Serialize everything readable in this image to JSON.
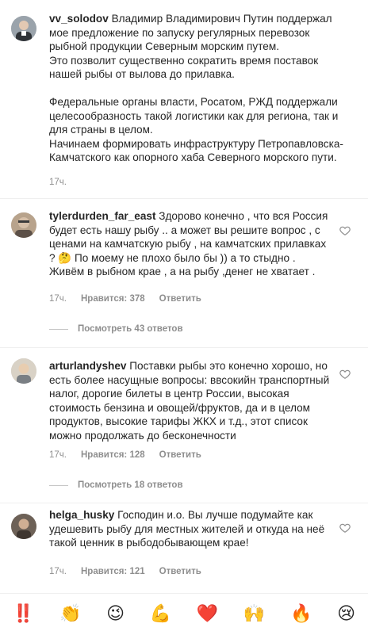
{
  "post": {
    "username": "vv_solodov",
    "paragraph1": "Владимир Владимирович Путин поддержал мое предложение по запуску регулярных перевозок рыбной продукции Северным морским путем.\nЭто позволит существенно сократить время поставок нашей рыбы от вылова до прилавка.",
    "paragraph2": "Федеральные органы власти, Росатом, РЖД поддержали целесообразность такой логистики как для региона, так и для страны в целом.\nНачинаем формировать инфраструктуру Петропавловска-Камчатского как опорного хаба Северного морского пути.",
    "time": "17ч."
  },
  "comments": [
    {
      "username": "tylerdurden_far_east",
      "text": "Здорово конечно , что вся Россия будет есть нашу рыбу .. а может вы решите вопрос , с ценами на камчатскую рыбу , на камчатских прилавках ? 🤔 По моему не плохо было бы )) а то стыдно . Живём в рыбном крае , а на рыбу ,денег не хватает .",
      "time": "17ч.",
      "likes": "Нравится: 378",
      "reply": "Ответить",
      "view_replies": "Посмотреть 43 ответов"
    },
    {
      "username": "arturlandyshev",
      "text": "Поставки рыбы это конечно хорошо, но есть более насущные вопросы: ввсокийн транспортный налог, дорогие билеты в центр России, высокая стоимость бензина и овощей/фруктов, да и в целом продуктов, высокие тарифы ЖКХ и т.д., этот список можно продолжать до бесконечности",
      "time": "17ч.",
      "likes": "Нравится: 128",
      "reply": "Ответить",
      "view_replies": "Посмотреть 18 ответов"
    },
    {
      "username": "helga_husky",
      "text": "Господин и.о. Вы лучше подумайте как удешевить рыбу для местных жителей и откуда на неё такой ценник в рыбодобывающем крае!",
      "time": "17ч.",
      "likes": "Нравится: 121",
      "reply": "Ответить"
    }
  ],
  "emoji_bar": [
    "‼️",
    "👏",
    "😉",
    "💪",
    "❤️",
    "🙌",
    "🔥",
    "😢"
  ],
  "icons": {
    "heart": "heart-outline-icon"
  },
  "colors": {
    "text": "#262626",
    "meta": "#8e8e8e",
    "heart_emoji": "#ed4956"
  }
}
